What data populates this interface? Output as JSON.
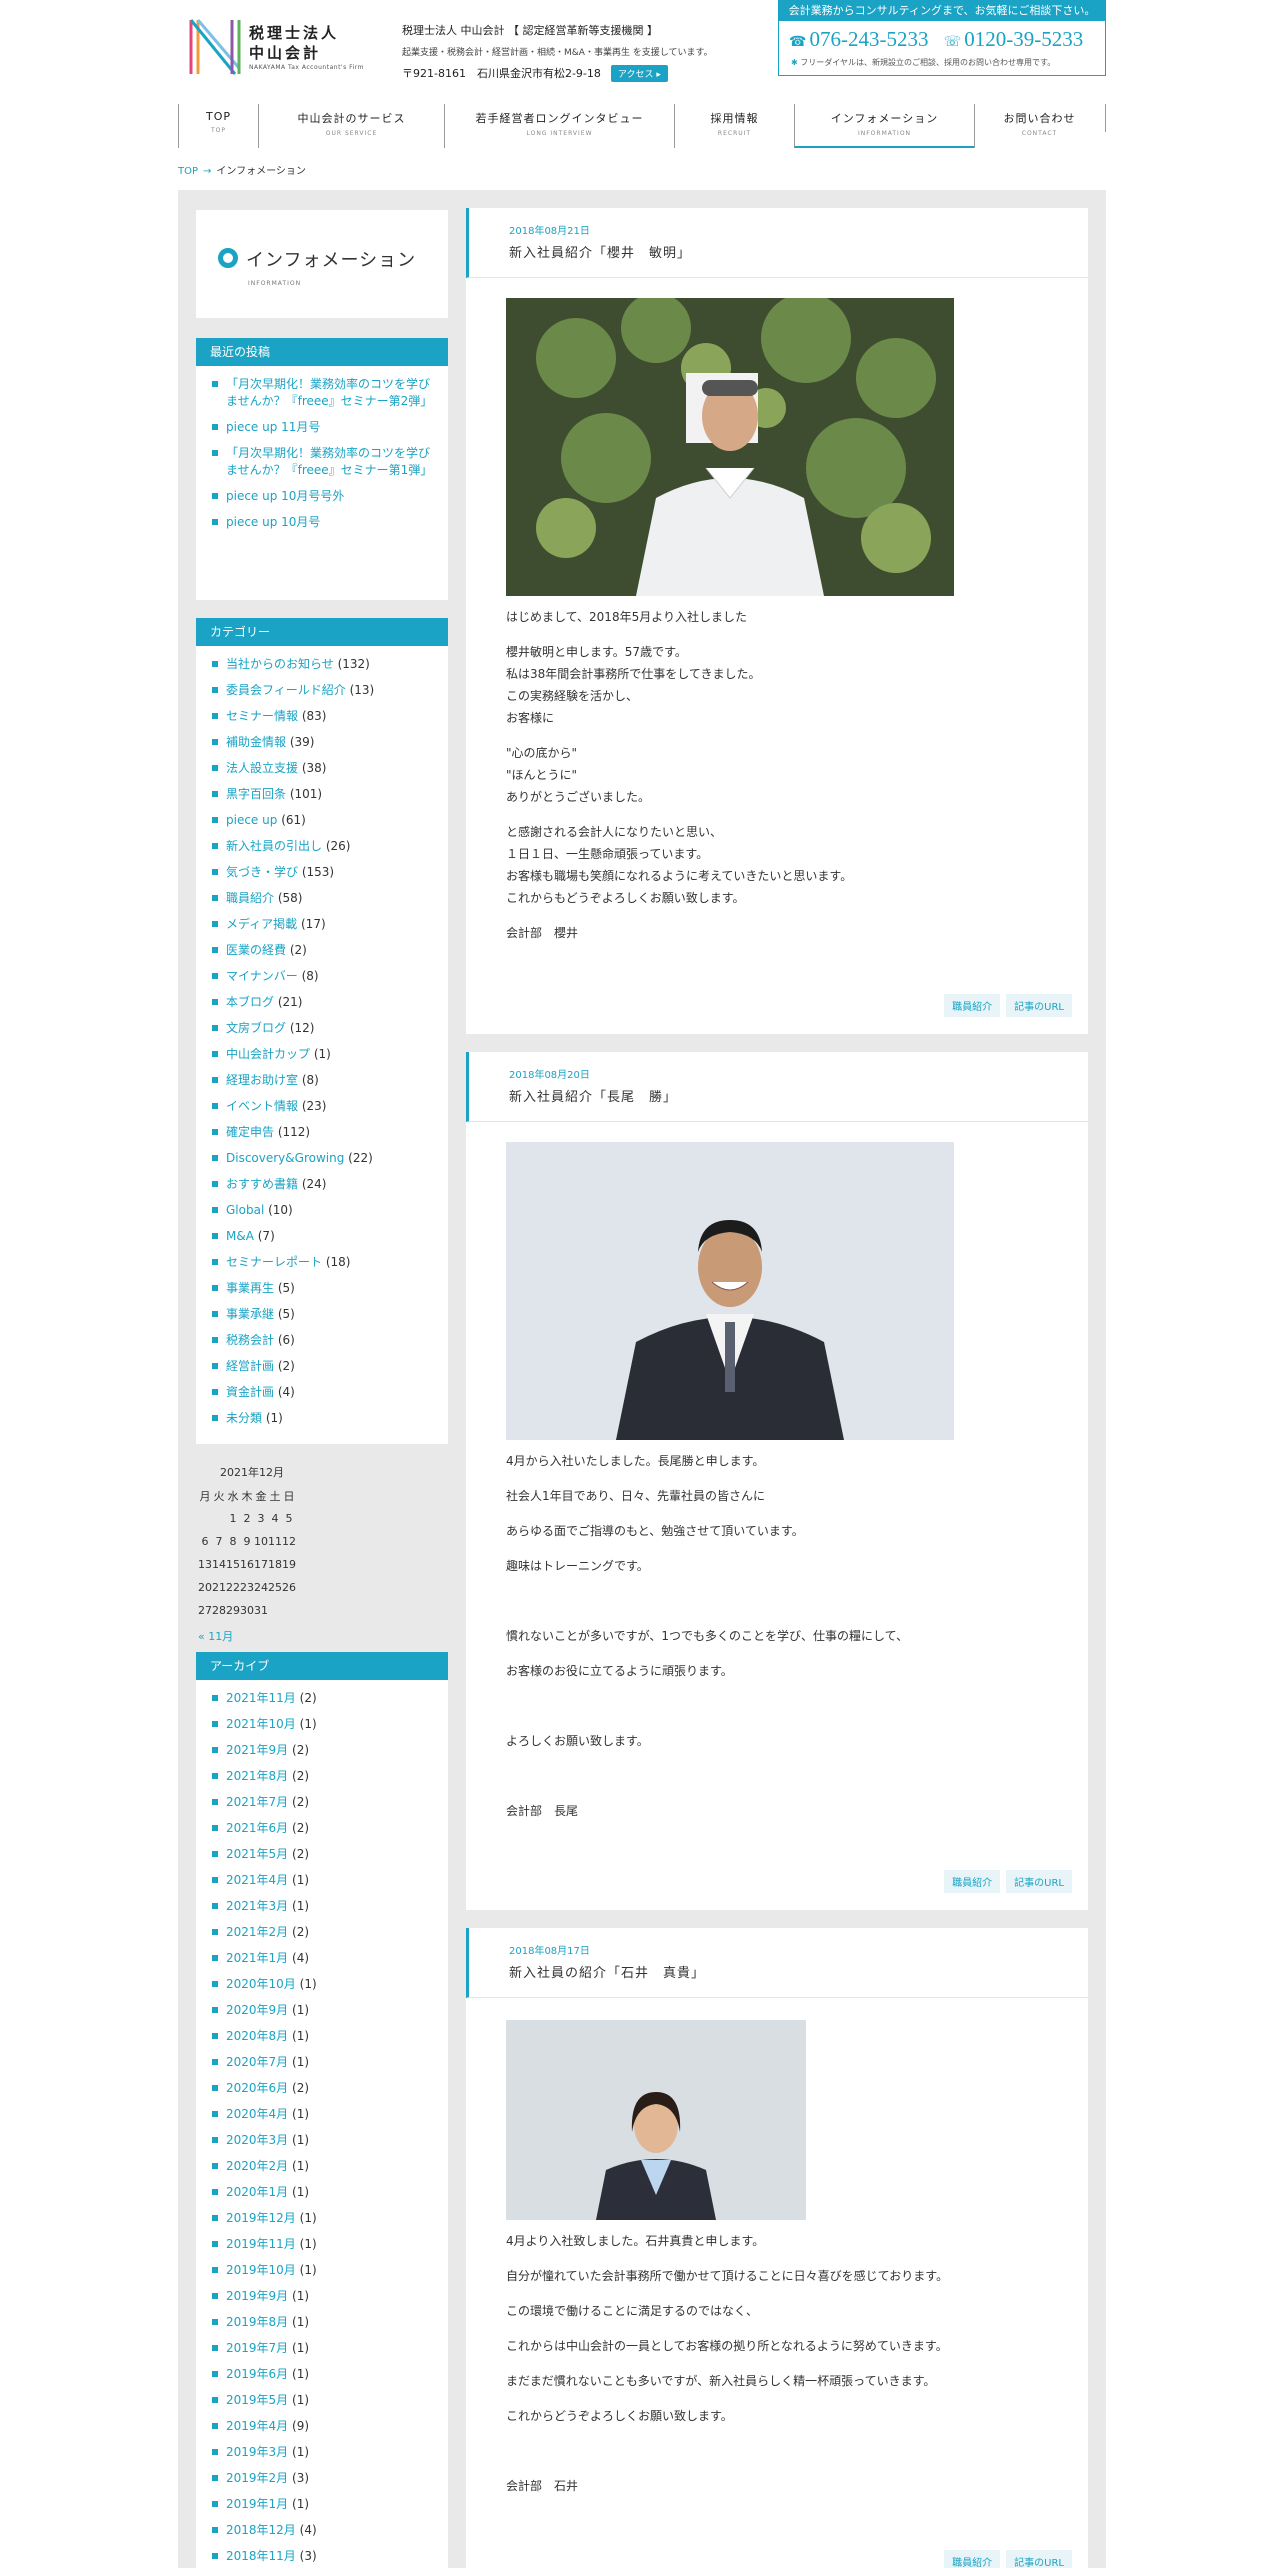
{
  "header": {
    "logo_name1": "税理士法人",
    "logo_name2": "中山会計",
    "logo_eng": "NAKAYAMA Tax Accountant's Firm",
    "info_line1": "税理士法人 中山会計 【 認定経営革新等支援機関 】",
    "info_line2": "起業支援・税務会計・経営計画・相続・M&A・事業再生 を支援しています。",
    "info_line3": "〒921-8161　石川県金沢市有松2-9-18",
    "access_label": "アクセス ▸",
    "contact_top": "会計業務からコンサルティングまで、お気軽にご相談下さい。",
    "tel_icon": "☎",
    "tel": "076-243-5233",
    "free_icon": "☏",
    "free": "0120-39-5233",
    "note_icon": "✱",
    "note": "フリーダイヤルは、新規設立のご相談、採用のお問い合わせ専用です。"
  },
  "nav": [
    {
      "jp": "TOP",
      "en": "TOP"
    },
    {
      "jp": "中山会計のサービス",
      "en": "OUR SERVICE"
    },
    {
      "jp": "若手経営者ロングインタビュー",
      "en": "LONG INTERVIEW"
    },
    {
      "jp": "採用情報",
      "en": "RECRUIT"
    },
    {
      "jp": "インフォメーション",
      "en": "INFORMATION"
    },
    {
      "jp": "お問い合わせ",
      "en": "CONTACT"
    }
  ],
  "breadcrumb": {
    "home": "TOP",
    "arrow": "→",
    "current": "インフォメーション"
  },
  "side_title": {
    "jp": "インフォメーション",
    "en": "INFORMATION"
  },
  "recent": {
    "heading": "最近の投稿",
    "items": [
      "「月次早期化！業務効率のコツを学びませんか？『freee』セミナー第2弾」",
      "piece up 11月号",
      "「月次早期化！業務効率のコツを学びませんか？『freee』セミナー第1弾」",
      "piece up 10月号号外",
      "piece up 10月号"
    ]
  },
  "categories": {
    "heading": "カテゴリー",
    "items": [
      {
        "name": "当社からのお知らせ",
        "count": "(132)"
      },
      {
        "name": "委員会フィールド紹介",
        "count": "(13)"
      },
      {
        "name": "セミナー情報",
        "count": "(83)"
      },
      {
        "name": "補助金情報",
        "count": "(39)"
      },
      {
        "name": "法人設立支援",
        "count": "(38)"
      },
      {
        "name": "黒字百回条",
        "count": "(101)"
      },
      {
        "name": "piece up",
        "count": "(61)"
      },
      {
        "name": "新入社員の引出し",
        "count": "(26)"
      },
      {
        "name": "気づき・学び",
        "count": "(153)"
      },
      {
        "name": "職員紹介",
        "count": "(58)"
      },
      {
        "name": "メディア掲載",
        "count": "(17)"
      },
      {
        "name": "医業の経費",
        "count": "(2)"
      },
      {
        "name": "マイナンバー",
        "count": "(8)"
      },
      {
        "name": "本ブログ",
        "count": "(21)"
      },
      {
        "name": "文房ブログ",
        "count": "(12)"
      },
      {
        "name": "中山会計カップ",
        "count": "(1)"
      },
      {
        "name": "経理お助け室",
        "count": "(8)"
      },
      {
        "name": "イベント情報",
        "count": "(23)"
      },
      {
        "name": "確定申告",
        "count": "(112)"
      },
      {
        "name": "Discovery&Growing",
        "count": "(22)"
      },
      {
        "name": "おすすめ書籍",
        "count": "(24)"
      },
      {
        "name": "Global",
        "count": "(10)"
      },
      {
        "name": "M&A",
        "count": "(7)"
      },
      {
        "name": "セミナーレポート",
        "count": "(18)"
      },
      {
        "name": "事業再生",
        "count": "(5)"
      },
      {
        "name": "事業承継",
        "count": "(5)"
      },
      {
        "name": "税務会計",
        "count": "(6)"
      },
      {
        "name": "経営計画",
        "count": "(2)"
      },
      {
        "name": "資金計画",
        "count": "(4)"
      },
      {
        "name": "未分類",
        "count": "(1)"
      }
    ]
  },
  "calendar": {
    "caption": "2021年12月",
    "weekdays": [
      "月",
      "火",
      "水",
      "木",
      "金",
      "土",
      "日"
    ],
    "weeks": [
      [
        "",
        "",
        "1",
        "2",
        "3",
        "4",
        "5"
      ],
      [
        "6",
        "7",
        "8",
        "9",
        "10",
        "11",
        "12"
      ],
      [
        "13",
        "14",
        "15",
        "16",
        "17",
        "18",
        "19"
      ],
      [
        "20",
        "21",
        "22",
        "23",
        "24",
        "25",
        "26"
      ],
      [
        "27",
        "28",
        "29",
        "30",
        "31",
        "",
        ""
      ]
    ],
    "prev": "« 11月"
  },
  "archive": {
    "heading": "アーカイブ",
    "items": [
      {
        "name": "2021年11月",
        "count": "(2)"
      },
      {
        "name": "2021年10月",
        "count": "(1)"
      },
      {
        "name": "2021年9月",
        "count": "(2)"
      },
      {
        "name": "2021年8月",
        "count": "(2)"
      },
      {
        "name": "2021年7月",
        "count": "(2)"
      },
      {
        "name": "2021年6月",
        "count": "(2)"
      },
      {
        "name": "2021年5月",
        "count": "(2)"
      },
      {
        "name": "2021年4月",
        "count": "(1)"
      },
      {
        "name": "2021年3月",
        "count": "(1)"
      },
      {
        "name": "2021年2月",
        "count": "(2)"
      },
      {
        "name": "2021年1月",
        "count": "(4)"
      },
      {
        "name": "2020年10月",
        "count": "(1)"
      },
      {
        "name": "2020年9月",
        "count": "(1)"
      },
      {
        "name": "2020年8月",
        "count": "(1)"
      },
      {
        "name": "2020年7月",
        "count": "(1)"
      },
      {
        "name": "2020年6月",
        "count": "(2)"
      },
      {
        "name": "2020年4月",
        "count": "(1)"
      },
      {
        "name": "2020年3月",
        "count": "(1)"
      },
      {
        "name": "2020年2月",
        "count": "(1)"
      },
      {
        "name": "2020年1月",
        "count": "(1)"
      },
      {
        "name": "2019年12月",
        "count": "(1)"
      },
      {
        "name": "2019年11月",
        "count": "(1)"
      },
      {
        "name": "2019年10月",
        "count": "(1)"
      },
      {
        "name": "2019年9月",
        "count": "(1)"
      },
      {
        "name": "2019年8月",
        "count": "(1)"
      },
      {
        "name": "2019年7月",
        "count": "(1)"
      },
      {
        "name": "2019年6月",
        "count": "(1)"
      },
      {
        "name": "2019年5月",
        "count": "(1)"
      },
      {
        "name": "2019年4月",
        "count": "(9)"
      },
      {
        "name": "2019年3月",
        "count": "(1)"
      },
      {
        "name": "2019年2月",
        "count": "(3)"
      },
      {
        "name": "2019年1月",
        "count": "(1)"
      },
      {
        "name": "2018年12月",
        "count": "(4)"
      },
      {
        "name": "2018年11月",
        "count": "(3)"
      }
    ]
  },
  "posts": [
    {
      "date": "2018年08月21日",
      "title": "新入社員紹介「櫻井　敏明」",
      "paragraphs": [
        [
          "はじめまして、2018年5月より入社しました"
        ],
        [
          "櫻井敏明と申します。57歳です。",
          "私は38年間会計事務所で仕事をしてきました。",
          "この実務経験を活かし、",
          "お客様に"
        ],
        [
          "\"心の底から\"",
          "\"ほんとうに\"",
          "ありがとうございました。"
        ],
        [
          "と感謝される会計人になりたいと思い、",
          "１日１日、一生懸命頑張っています。",
          "お客様も職場も笑顔になれるように考えていきたいと思います。",
          "これからもどうぞよろしくお願い致します。"
        ],
        [
          "会計部　櫻井"
        ]
      ],
      "tags": [
        "職員紹介",
        "記事のURL"
      ]
    },
    {
      "date": "2018年08月20日",
      "title": "新入社員紹介「長尾　勝」",
      "paragraphs": [
        [
          "4月から入社いたしました。長尾勝と申します。"
        ],
        [
          "社会人1年目であり、日々、先輩社員の皆さんに"
        ],
        [
          "あらゆる面でご指導のもと、勉強させて頂いています。"
        ],
        [
          "趣味はトレーニングです。"
        ],
        [
          ""
        ],
        [
          "慣れないことが多いですが、1つでも多くのことを学び、仕事の糧にして、"
        ],
        [
          "お客様のお役に立てるように頑張ります。"
        ],
        [
          ""
        ],
        [
          "よろしくお願い致します。"
        ],
        [
          ""
        ],
        [
          "会計部　長尾"
        ]
      ],
      "tags": [
        "職員紹介",
        "記事のURL"
      ]
    },
    {
      "date": "2018年08月17日",
      "title": "新入社員の紹介「石井　真貴」",
      "paragraphs": [
        [
          "4月より入社致しました。石井真貴と申します。"
        ],
        [
          "自分が憧れていた会計事務所で働かせて頂けることに日々喜びを感じております。"
        ],
        [
          "この環境で働けることに満足するのではなく、"
        ],
        [
          "これからは中山会計の一員としてお客様の拠り所となれるように努めていきます。"
        ],
        [
          "まだまだ慣れないことも多いですが、新入社員らしく精一杯頑張っていきます。"
        ],
        [
          "これからどうぞよろしくお願い致します。"
        ],
        [
          ""
        ],
        [
          "会計部　石井"
        ]
      ],
      "tags": [
        "職員紹介",
        "記事のURL"
      ]
    }
  ],
  "colors": {
    "accent": "#1aa3c4",
    "bg_gray": "#e9e9e9"
  }
}
